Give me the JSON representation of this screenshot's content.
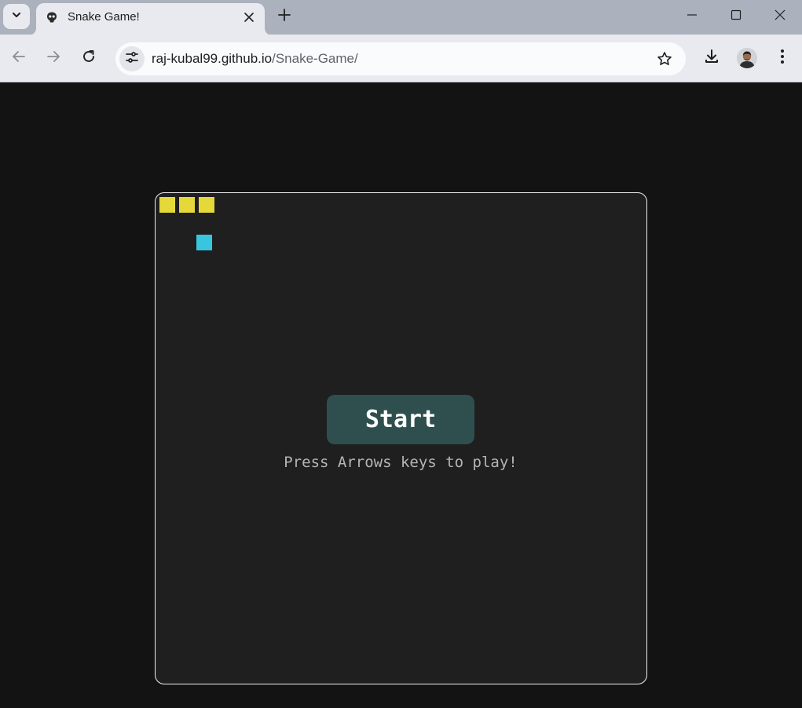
{
  "browser": {
    "tab": {
      "title": "Snake Game!"
    },
    "omnibox": {
      "host": "raj-kubal99.github.io",
      "path": "/Snake-Game/"
    }
  },
  "game": {
    "start_label": "Start",
    "hint": "Press Arrows keys to play!",
    "colors": {
      "snake": "#e4d83a",
      "food": "#38c5dd",
      "button": "#2f4f4f",
      "board": "#1f1f1f"
    }
  }
}
